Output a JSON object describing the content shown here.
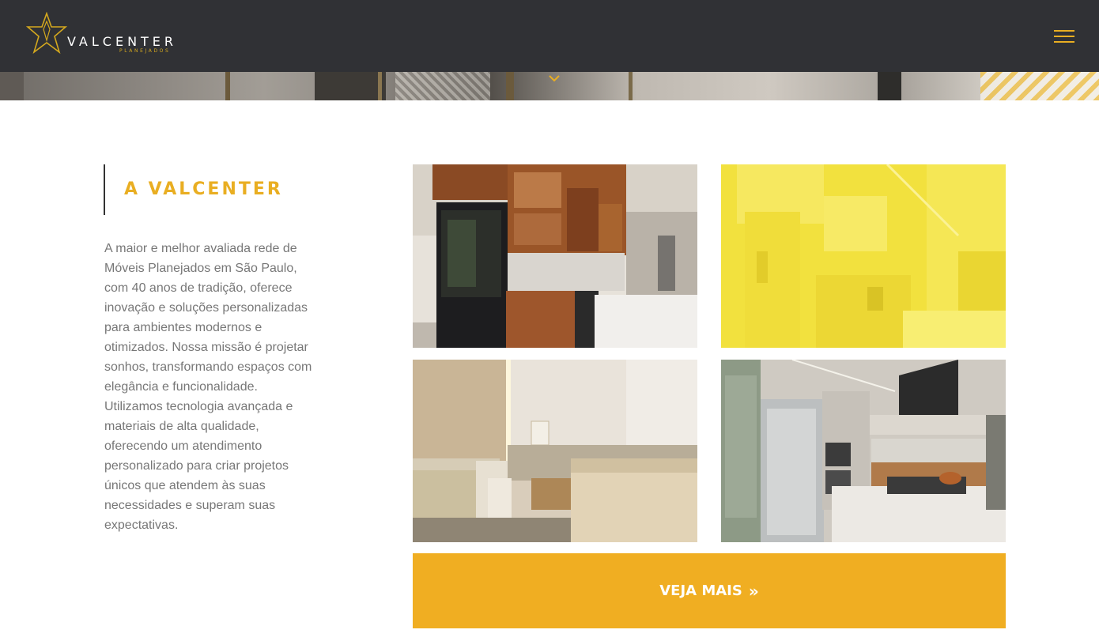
{
  "header": {
    "brand": "VALCENTER",
    "brand_sub": "PLANEJADOS",
    "menu_icon": "hamburger-icon",
    "accent_color": "#e9ae22",
    "background_color": "#303135"
  },
  "hero": {
    "scroll_icon": "chevron-down-icon"
  },
  "about": {
    "title": "A VALCENTER",
    "description": "A maior e melhor avaliada rede de Móveis Planejados em São Paulo, com 40 anos de tradição, oferece inovação e soluções personalizadas para ambientes modernos e otimizados. Nossa missão é projetar sonhos, transformando espaços com elegância e funcionalidade. Utilizamos tecnologia avançada e materiais de alta qualidade, oferecendo um atendimento personalizado para criar projetos únicos que atendem às suas necessidades e superam suas expectativas."
  },
  "gallery": [
    {
      "subject": "wood kitchen with black refrigerator"
    },
    {
      "subject": "white kitchen with yellow overlay"
    },
    {
      "subject": "bedroom with desk and bed"
    },
    {
      "subject": "modern kitchen with steel refrigerator"
    }
  ],
  "cta": {
    "label": "VEJA MAIS",
    "icon": "double-chevron-right-icon",
    "color": "#f0ae22"
  }
}
